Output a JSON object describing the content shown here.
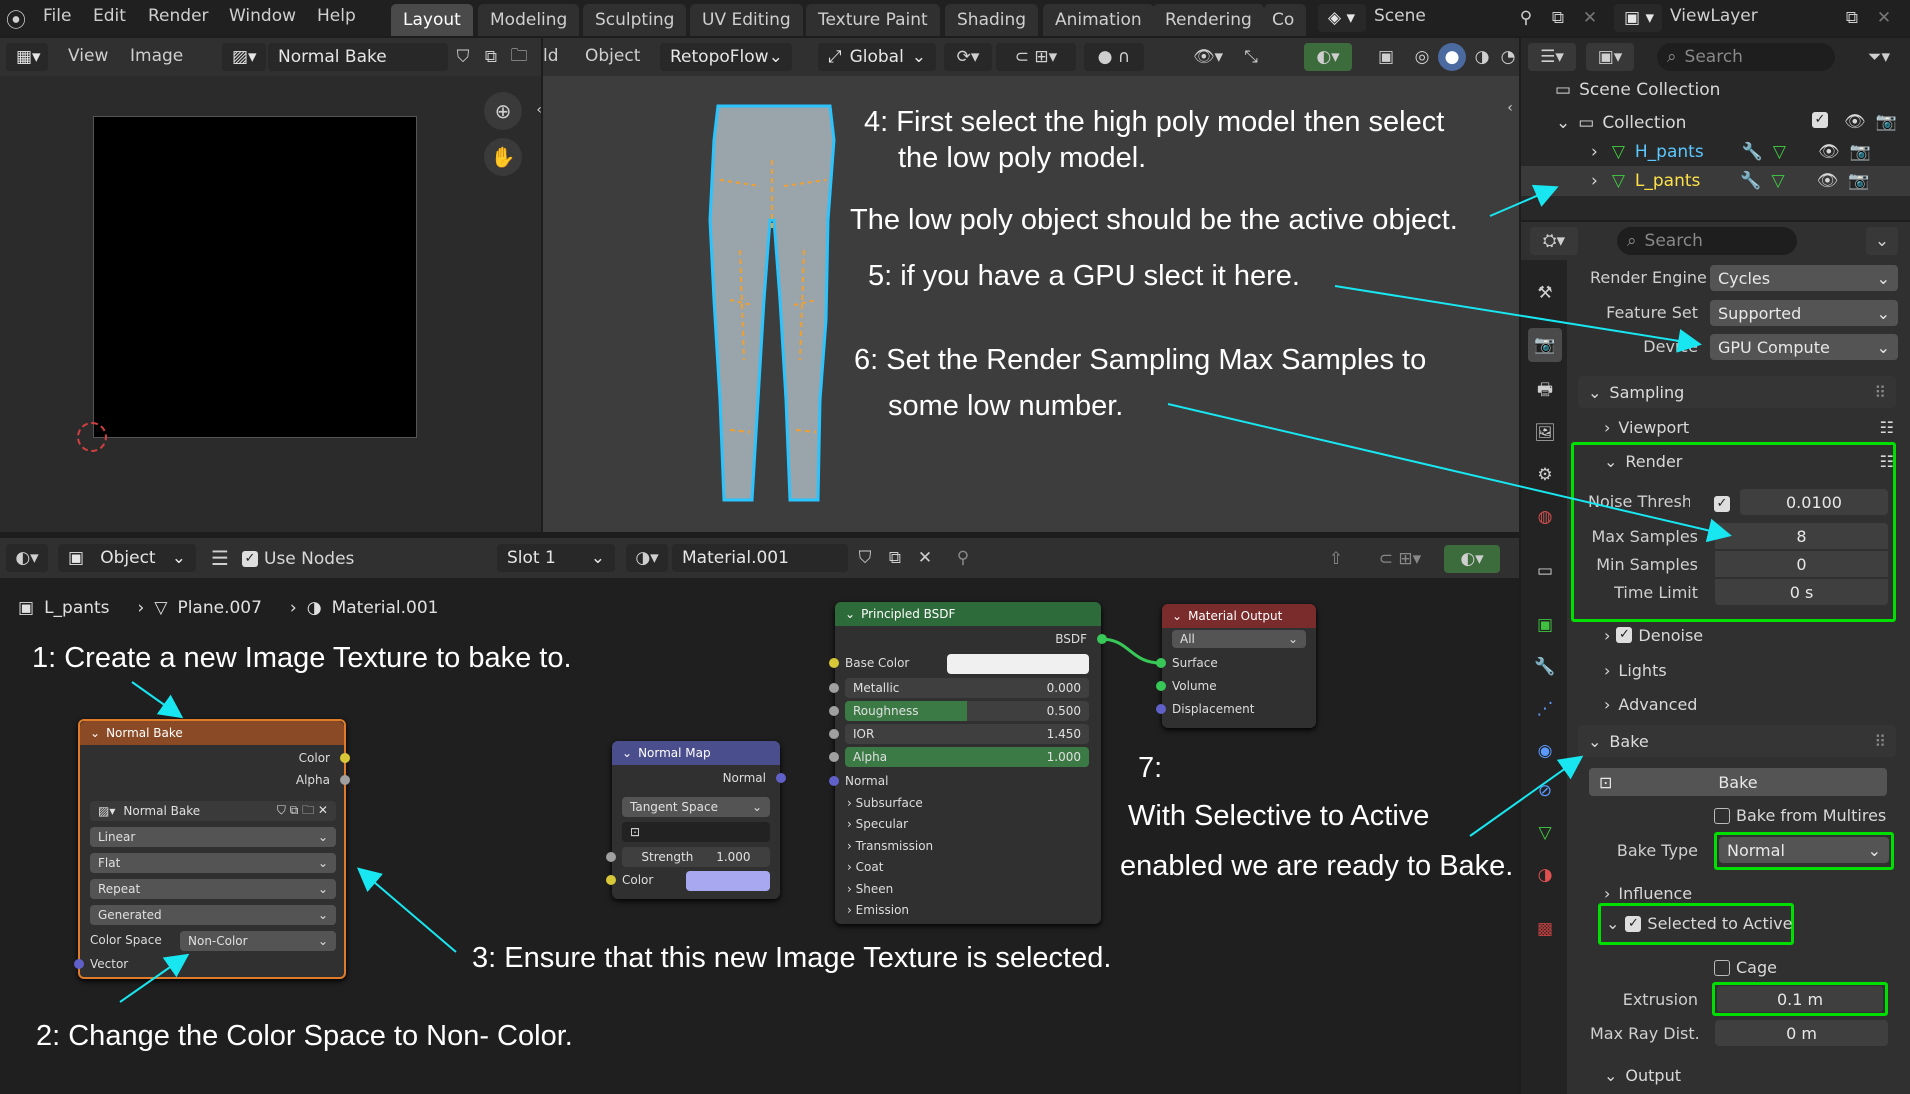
{
  "topbar": {
    "menus": [
      "File",
      "Edit",
      "Render",
      "Window",
      "Help"
    ],
    "workspaces": [
      "Layout",
      "Modeling",
      "Sculpting",
      "UV Editing",
      "Texture Paint",
      "Shading",
      "Animation",
      "Rendering",
      "Co"
    ],
    "active_workspace": "Layout",
    "scene": "Scene",
    "view_layer": "ViewLayer"
  },
  "image_editor": {
    "menus": [
      "View",
      "Image"
    ],
    "image_name": "Normal Bake"
  },
  "viewport_header": {
    "menus": [
      "ld",
      "Object"
    ],
    "retopo": "RetopoFlow",
    "transform": "Global"
  },
  "node_editor": {
    "mode": "Object",
    "use_nodes_label": "Use Nodes",
    "slot": "Slot 1",
    "material": "Material.001",
    "breadcrumb": [
      "L_pants",
      "Plane.007",
      "Material.001"
    ]
  },
  "nodes": {
    "image_texture": {
      "title": "Normal Bake",
      "outputs": [
        "Color",
        "Alpha"
      ],
      "image": "Normal Bake",
      "interpolation": "Linear",
      "projection": "Flat",
      "extension": "Repeat",
      "source": "Generated",
      "color_space_label": "Color Space",
      "color_space": "Non-Color",
      "input": "Vector"
    },
    "normal_map": {
      "title": "Normal Map",
      "output": "Normal",
      "space": "Tangent Space",
      "strength_label": "Strength",
      "strength": "1.000",
      "color_label": "Color",
      "color_value": "#a8a8f0"
    },
    "bsdf": {
      "title": "Principled BSDF",
      "output": "BSDF",
      "base_color": "Base Color",
      "metallic_label": "Metallic",
      "metallic": "0.000",
      "roughness_label": "Roughness",
      "roughness": "0.500",
      "ior_label": "IOR",
      "ior": "1.450",
      "alpha_label": "Alpha",
      "alpha": "1.000",
      "normal": "Normal",
      "panels": [
        "Subsurface",
        "Specular",
        "Transmission",
        "Coat",
        "Sheen",
        "Emission"
      ]
    },
    "output": {
      "title": "Material Output",
      "target": "All",
      "inputs": [
        "Surface",
        "Volume",
        "Displacement"
      ]
    }
  },
  "outliner": {
    "search_placeholder": "Search",
    "scene_collection": "Scene Collection",
    "collection": "Collection",
    "objects": [
      {
        "name": "H_pants",
        "color": "#5bc8ff"
      },
      {
        "name": "L_pants",
        "color": "#ffe14a"
      }
    ]
  },
  "properties": {
    "search_placeholder": "Search",
    "render_engine_label": "Render Engine",
    "render_engine": "Cycles",
    "feature_set_label": "Feature Set",
    "feature_set": "Supported",
    "device_label": "Device",
    "device": "GPU Compute",
    "sampling": "Sampling",
    "viewport": "Viewport",
    "render": "Render",
    "noise_label": "Noise Thresh...",
    "noise_value": "0.0100",
    "max_samples_label": "Max Samples",
    "max_samples": "8",
    "min_samples_label": "Min Samples",
    "min_samples": "0",
    "time_limit_label": "Time Limit",
    "time_limit": "0 s",
    "denoise": "Denoise",
    "lights": "Lights",
    "advanced": "Advanced",
    "bake": "Bake",
    "bake_button": "Bake",
    "bake_from_multires": "Bake from Multires",
    "bake_type_label": "Bake Type",
    "bake_type": "Normal",
    "influence": "Influence",
    "selected_to_active": "Selected to Active",
    "cage": "Cage",
    "extrusion_label": "Extrusion",
    "extrusion": "0.1 m",
    "max_ray_label": "Max Ray Dist...",
    "max_ray": "0 m",
    "output": "Output"
  },
  "annotations": {
    "a1": "1: Create a new Image Texture to bake to.",
    "a2": "2: Change the Color Space to Non- Color.",
    "a3": "3: Ensure that this new Image Texture is selected.",
    "a4a": "4: First select the high poly model then select",
    "a4b": "the low poly model.",
    "a4c": "The low poly object should be the active object.",
    "a5": "5: if you have a GPU slect it here.",
    "a6a": "6: Set the Render Sampling Max Samples to",
    "a6b": "some low number.",
    "a7a": "7:",
    "a7b": "With Selective to Active",
    "a7c": "enabled we are ready to Bake."
  },
  "colors": {
    "arrow": "#18e6f0",
    "highlight": "#00e000",
    "tex_header": "#8a4a25",
    "vec_header": "#4a4e8c",
    "shader_header": "#2e6b3b",
    "output_header": "#7a2b2b"
  }
}
